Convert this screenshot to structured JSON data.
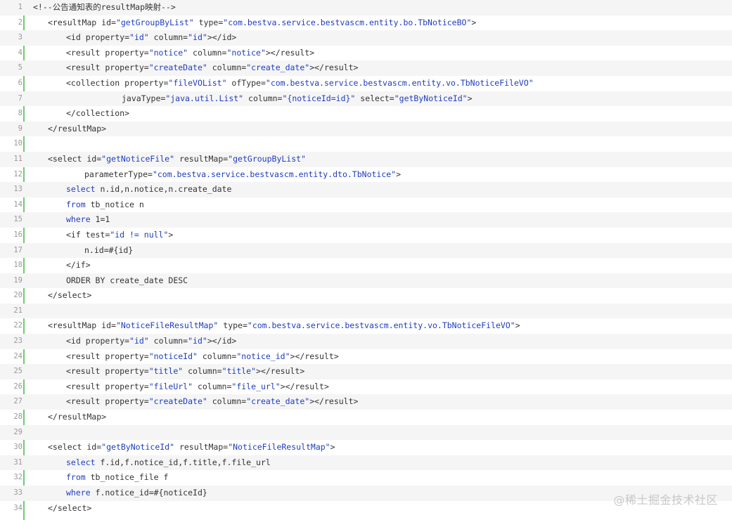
{
  "lines": [
    {
      "n": "1",
      "indent": 0,
      "tokens": [
        [
          "plain",
          "<!--公告通知表的resultMap映射-->"
        ]
      ]
    },
    {
      "n": "2",
      "indent": 1,
      "tokens": [
        [
          "plain",
          "<resultMap id="
        ],
        [
          "str",
          "\"getGroupByList\""
        ],
        [
          "plain",
          " type="
        ],
        [
          "str",
          "\"com.bestva.service.bestvascm.entity.bo.TbNoticeBO\""
        ],
        [
          "plain",
          ">"
        ]
      ]
    },
    {
      "n": "3",
      "indent": 2,
      "tokens": [
        [
          "plain",
          "<id property="
        ],
        [
          "str",
          "\"id\""
        ],
        [
          "plain",
          " column="
        ],
        [
          "str",
          "\"id\""
        ],
        [
          "plain",
          "></id>"
        ]
      ]
    },
    {
      "n": "4",
      "indent": 2,
      "tokens": [
        [
          "plain",
          "<result property="
        ],
        [
          "str",
          "\"notice\""
        ],
        [
          "plain",
          " column="
        ],
        [
          "str",
          "\"notice\""
        ],
        [
          "plain",
          "></result>"
        ]
      ]
    },
    {
      "n": "5",
      "indent": 2,
      "tokens": [
        [
          "plain",
          "<result property="
        ],
        [
          "str",
          "\"createDate\""
        ],
        [
          "plain",
          " column="
        ],
        [
          "str",
          "\"create_date\""
        ],
        [
          "plain",
          "></result>"
        ]
      ]
    },
    {
      "n": "6",
      "indent": 2,
      "tokens": [
        [
          "plain",
          "<collection property="
        ],
        [
          "str",
          "\"fileVOList\""
        ],
        [
          "plain",
          " ofType="
        ],
        [
          "str",
          "\"com.bestva.service.bestvascm.entity.vo.TbNoticeFileVO\""
        ]
      ]
    },
    {
      "n": "7",
      "indent": 5,
      "tokens": [
        [
          "plain",
          "javaType="
        ],
        [
          "str",
          "\"java.util.List\""
        ],
        [
          "plain",
          " column="
        ],
        [
          "str",
          "\"{noticeId=id}\""
        ],
        [
          "plain",
          " select="
        ],
        [
          "str",
          "\"getByNoticeId\""
        ],
        [
          "plain",
          ">"
        ]
      ]
    },
    {
      "n": "8",
      "indent": 2,
      "tokens": [
        [
          "plain",
          "</collection>"
        ]
      ]
    },
    {
      "n": "9",
      "indent": 1,
      "tokens": [
        [
          "plain",
          "</resultMap>"
        ]
      ]
    },
    {
      "n": "10",
      "indent": 0,
      "tokens": []
    },
    {
      "n": "11",
      "indent": 1,
      "tokens": [
        [
          "plain",
          "<select id="
        ],
        [
          "str",
          "\"getNoticeFile\""
        ],
        [
          "plain",
          " resultMap="
        ],
        [
          "str",
          "\"getGroupByList\""
        ]
      ]
    },
    {
      "n": "12",
      "indent": 3,
      "tokens": [
        [
          "plain",
          "parameterType="
        ],
        [
          "str",
          "\"com.bestva.service.bestvascm.entity.dto.TbNotice\""
        ],
        [
          "plain",
          ">"
        ]
      ]
    },
    {
      "n": "13",
      "indent": 2,
      "tokens": [
        [
          "kw",
          "select"
        ],
        [
          "plain",
          " n.id,n.notice,n.create_date"
        ]
      ]
    },
    {
      "n": "14",
      "indent": 2,
      "tokens": [
        [
          "kw",
          "from"
        ],
        [
          "plain",
          " tb_notice n"
        ]
      ]
    },
    {
      "n": "15",
      "indent": 2,
      "tokens": [
        [
          "kw",
          "where"
        ],
        [
          "plain",
          " 1=1"
        ]
      ]
    },
    {
      "n": "16",
      "indent": 2,
      "tokens": [
        [
          "plain",
          "<if test="
        ],
        [
          "str",
          "\"id != null\""
        ],
        [
          "plain",
          ">"
        ]
      ]
    },
    {
      "n": "17",
      "indent": 3,
      "tokens": [
        [
          "plain",
          "n.id=#{id}"
        ]
      ]
    },
    {
      "n": "18",
      "indent": 2,
      "tokens": [
        [
          "plain",
          "</if>"
        ]
      ]
    },
    {
      "n": "19",
      "indent": 2,
      "tokens": [
        [
          "plain",
          "ORDER BY create_date DESC"
        ]
      ]
    },
    {
      "n": "20",
      "indent": 1,
      "tokens": [
        [
          "plain",
          "</select>"
        ]
      ]
    },
    {
      "n": "21",
      "indent": 0,
      "tokens": []
    },
    {
      "n": "22",
      "indent": 1,
      "tokens": [
        [
          "plain",
          "<resultMap id="
        ],
        [
          "str",
          "\"NoticeFileResultMap\""
        ],
        [
          "plain",
          " type="
        ],
        [
          "str",
          "\"com.bestva.service.bestvascm.entity.vo.TbNoticeFileVO\""
        ],
        [
          "plain",
          ">"
        ]
      ]
    },
    {
      "n": "23",
      "indent": 2,
      "tokens": [
        [
          "plain",
          "<id property="
        ],
        [
          "str",
          "\"id\""
        ],
        [
          "plain",
          " column="
        ],
        [
          "str",
          "\"id\""
        ],
        [
          "plain",
          "></id>"
        ]
      ]
    },
    {
      "n": "24",
      "indent": 2,
      "tokens": [
        [
          "plain",
          "<result property="
        ],
        [
          "str",
          "\"noticeId\""
        ],
        [
          "plain",
          " column="
        ],
        [
          "str",
          "\"notice_id\""
        ],
        [
          "plain",
          "></result>"
        ]
      ]
    },
    {
      "n": "25",
      "indent": 2,
      "tokens": [
        [
          "plain",
          "<result property="
        ],
        [
          "str",
          "\"title\""
        ],
        [
          "plain",
          " column="
        ],
        [
          "str",
          "\"title\""
        ],
        [
          "plain",
          "></result>"
        ]
      ]
    },
    {
      "n": "26",
      "indent": 2,
      "tokens": [
        [
          "plain",
          "<result property="
        ],
        [
          "str",
          "\"fileUrl\""
        ],
        [
          "plain",
          " column="
        ],
        [
          "str",
          "\"file_url\""
        ],
        [
          "plain",
          "></result>"
        ]
      ]
    },
    {
      "n": "27",
      "indent": 2,
      "tokens": [
        [
          "plain",
          "<result property="
        ],
        [
          "str",
          "\"createDate\""
        ],
        [
          "plain",
          " column="
        ],
        [
          "str",
          "\"create_date\""
        ],
        [
          "plain",
          "></result>"
        ]
      ]
    },
    {
      "n": "28",
      "indent": 1,
      "tokens": [
        [
          "plain",
          "</resultMap>"
        ]
      ]
    },
    {
      "n": "29",
      "indent": 0,
      "tokens": []
    },
    {
      "n": "30",
      "indent": 1,
      "tokens": [
        [
          "plain",
          "<select id="
        ],
        [
          "str",
          "\"getByNoticeId\""
        ],
        [
          "plain",
          " resultMap="
        ],
        [
          "str",
          "\"NoticeFileResultMap\""
        ],
        [
          "plain",
          ">"
        ]
      ]
    },
    {
      "n": "31",
      "indent": 2,
      "tokens": [
        [
          "kw",
          "select"
        ],
        [
          "plain",
          " f.id,f.notice_id,f.title,f.file_url"
        ]
      ]
    },
    {
      "n": "32",
      "indent": 2,
      "tokens": [
        [
          "kw",
          "from"
        ],
        [
          "plain",
          " tb_notice_file f"
        ]
      ]
    },
    {
      "n": "33",
      "indent": 2,
      "tokens": [
        [
          "kw",
          "where"
        ],
        [
          "plain",
          " f.notice_id=#{noticeId}"
        ]
      ]
    },
    {
      "n": "34",
      "indent": 1,
      "tokens": [
        [
          "plain",
          "</select>"
        ]
      ]
    }
  ],
  "watermark": "@稀土掘金技术社区",
  "colors": {
    "string": "#1f3dbf",
    "keyword": "#1f3dbf",
    "gutter_rule": "#6ecc6e",
    "alt_row": "#f5f5f5"
  }
}
